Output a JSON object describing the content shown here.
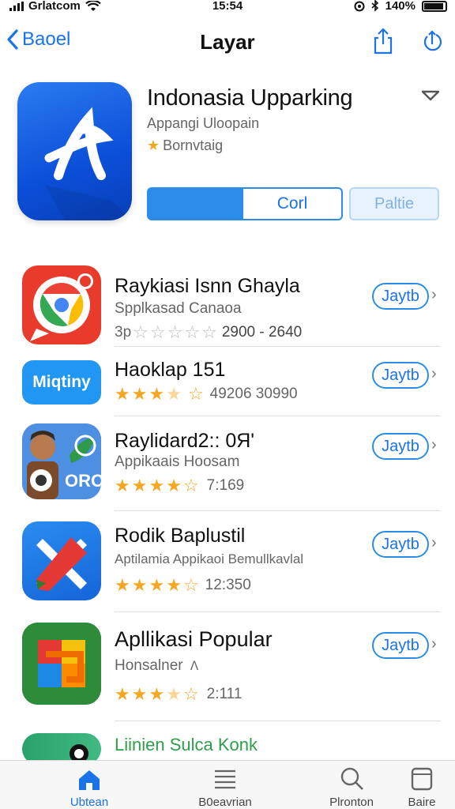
{
  "status_bar": {
    "carrier": "Grlatcom",
    "time": "15:54",
    "battery": "140%"
  },
  "nav": {
    "back_label": "Baoel",
    "title": "Layar"
  },
  "hero": {
    "name": "Indonasia Upparking",
    "subtitle": "Appangi Uloopain",
    "rating_text": "Bornvtaig",
    "button_open": "Corl",
    "button_secondary": "Paltie"
  },
  "apps": [
    {
      "name": "Raykiasi Isnn Ghayla",
      "subtitle": "Spplkasad Canaoa",
      "rating_prefix": "3p",
      "rating_text": "2900 - 2640",
      "stars": [
        0,
        0,
        0,
        0,
        0
      ],
      "get_label": "Jaytb"
    },
    {
      "name": "Haoklap 151",
      "subtitle": "",
      "rating_prefix": "",
      "rating_text": "49206 30990",
      "stars": [
        1,
        1,
        1,
        0.5,
        0
      ],
      "get_label": "Jaytb",
      "icon_text": "Miqtiny"
    },
    {
      "name": "Raylidard2:: 0Я'",
      "subtitle": "Appikaais Hoosam",
      "rating_prefix": "",
      "rating_text": "7:169",
      "stars": [
        1,
        1,
        1,
        1,
        0
      ],
      "get_label": "Jaytb",
      "icon_text": "ORO"
    },
    {
      "name": "Rodik Baplustil",
      "subtitle": "Aptilamia Appikaoi Bemullkavlal",
      "rating_prefix": "",
      "rating_text": "12:350",
      "stars": [
        1,
        1,
        1,
        1,
        0
      ],
      "get_label": "Jaytb"
    },
    {
      "name": "Apllikasi Popular",
      "subtitle": "Honsalner",
      "rating_prefix": "",
      "rating_text": "2:111",
      "stars": [
        1,
        1,
        1,
        0.5,
        0
      ],
      "get_label": "Jaytb"
    },
    {
      "name": "Liinien Sulca Konk",
      "subtitle": "",
      "rating_prefix": "",
      "rating_text": "",
      "stars": [],
      "get_label": ""
    }
  ],
  "tabs": [
    {
      "label": "Ubtean",
      "icon": "home-icon",
      "active": true
    },
    {
      "label": "B0eavrian",
      "icon": "list-icon",
      "active": false
    },
    {
      "label": "Plronton",
      "icon": "search-icon",
      "active": false
    },
    {
      "label": "Baire",
      "icon": "box-icon",
      "active": false
    }
  ],
  "colors": {
    "accent": "#1a73e8",
    "star": "#f5a623"
  }
}
